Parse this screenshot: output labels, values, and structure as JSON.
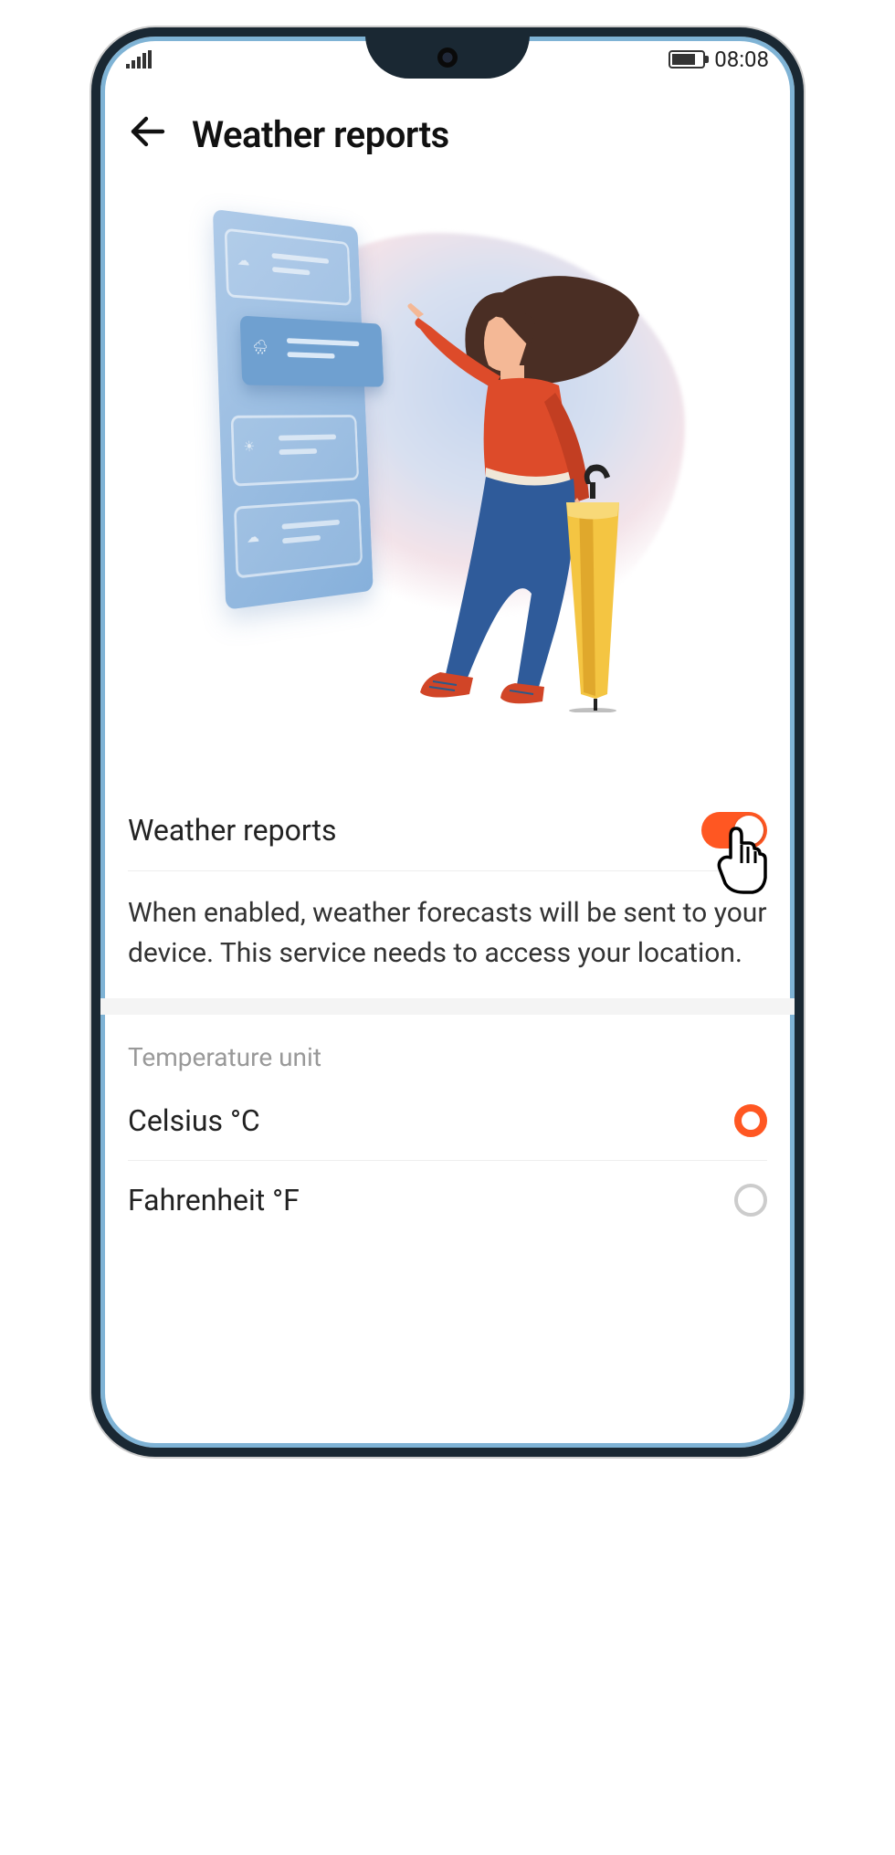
{
  "status": {
    "time": "08:08"
  },
  "header": {
    "title": "Weather reports"
  },
  "settings": {
    "toggle_label": "Weather reports",
    "toggle_on": true,
    "description": "When enabled, weather forecasts will be sent to your device. This service needs to access your location.",
    "temp_section_label": "Temperature unit",
    "options": [
      {
        "label": "Celsius °C",
        "selected": true
      },
      {
        "label": "Fahrenheit °F",
        "selected": false
      }
    ]
  }
}
